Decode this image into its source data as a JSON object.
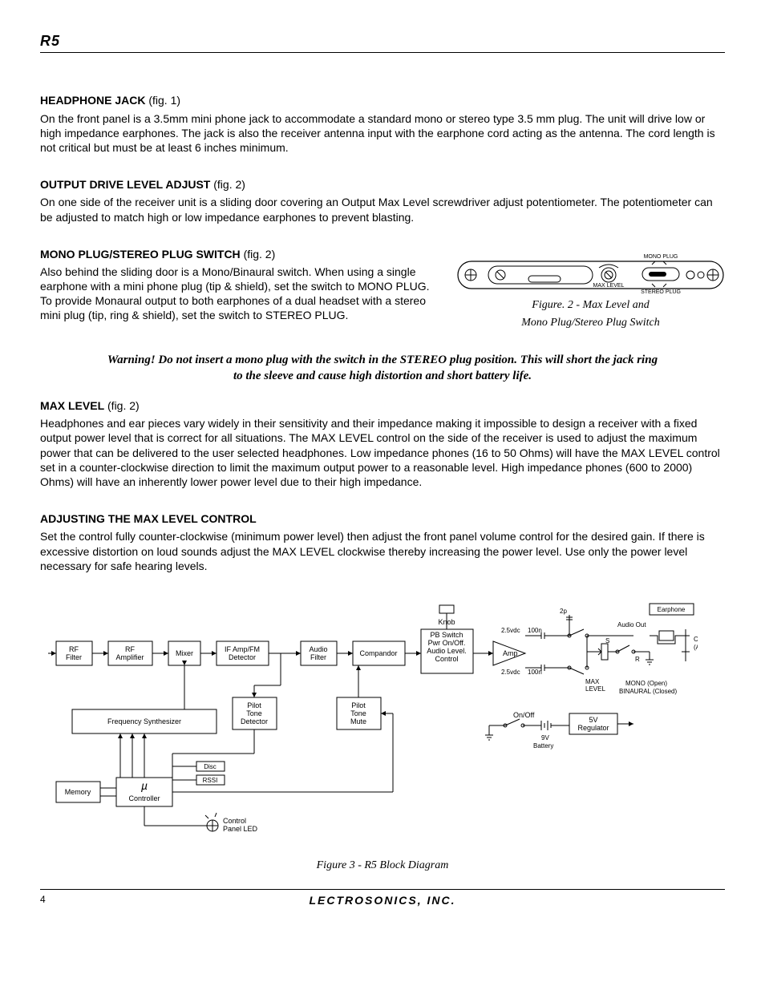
{
  "header": {
    "model": "R5"
  },
  "sections": {
    "headphone": {
      "title": "HEADPHONE JACK",
      "fig": "(fig. 1)",
      "body": "On the front panel is a 3.5mm mini phone jack to accommodate a standard mono or stereo type 3.5 mm plug.  The unit will drive low or high impedance earphones.  The jack is also the receiver antenna input with the earphone cord acting as the antenna.  The cord length is not critical but must be at least 6 inches minimum."
    },
    "output": {
      "title": "OUTPUT DRIVE LEVEL ADJUST",
      "fig": "(fig. 2)",
      "body": "On one side of the receiver unit is a sliding door covering an Output Max Level screwdriver adjust potentiometer.  The potentiometer can be adjusted to match high or low impedance earphones to prevent blasting."
    },
    "mono": {
      "title": "MONO PLUG/STEREO PLUG SWITCH",
      "fig": "(fig. 2)",
      "body": "Also behind the sliding door is a Mono/Binaural switch.  When using a single earphone with a mini phone plug (tip & shield), set the switch to MONO PLUG.  To provide Monaural output to both earphones of a dual headset with a stereo mini plug (tip, ring & shield), set the switch to STEREO PLUG."
    },
    "maxlevel": {
      "title": "MAX LEVEL",
      "fig": "(fig. 2)",
      "body": "Headphones and ear pieces vary widely in their sensitivity and their impedance making it impossible to design a receiver with a fixed output power level that is correct for all situations.  The MAX LEVEL control on the side of the receiver is used to adjust the maximum power that can be delivered to the user selected headphones.  Low impedance phones (16 to 50 Ohms) will have the MAX LEVEL control set in a counter-clockwise direction to limit the maximum output power to a reasonable level.  High impedance phones (600 to 2000) Ohms) will have an inherently lower power level due to their high impedance."
    },
    "adjust": {
      "title": "ADJUSTING THE MAX LEVEL CONTROL",
      "body": "Set the control fully counter-clockwise (minimum power level) then adjust the front panel volume control for the desired gain.  If there is excessive distortion on loud sounds adjust the MAX LEVEL clockwise thereby increasing the power level.  Use only the power level necessary for safe hearing levels."
    }
  },
  "warning": "Warning!  Do not insert a mono plug with the switch in the STEREO plug position.  This will short the jack ring to the sleeve and cause high distortion and short battery life.",
  "fig2": {
    "caption1": "Figure. 2 - Max Level and",
    "caption2": "Mono Plug/Stereo Plug Switch",
    "labels": {
      "mono": "MONO PLUG",
      "stereo": "STEREO PLUG",
      "max": "MAX LEVEL"
    }
  },
  "fig3": {
    "caption": "Figure 3 - R5 Block Diagram",
    "labels": {
      "rf_filter": "RF Filter",
      "rf_amp": "RF Amplifier",
      "mixer": "Mixer",
      "if_amp": "IF Amp/FM Detector",
      "audio_filter": "Audio Filter",
      "compandor": "Compandor",
      "knob": "Knob",
      "pb_switch": "PB Switch Pwr On/Off. Audio Level. Control",
      "amp": "Amp",
      "earphone": "Earphone",
      "cord": "Cord (Ant.)",
      "freq_synth": "Frequency Synthesizer",
      "pilot_detect": "Pilot Tone Detector",
      "pilot_mute": "Pilot Tone Mute",
      "memory": "Memory",
      "controller": "Controller",
      "mu": "µ",
      "disc": "Disc",
      "rssi": "RSSI",
      "panel_led": "Control Panel LED",
      "onoff": "On/Off",
      "battery": "9V Battery",
      "regulator": "5V Regulator",
      "max_level": "MAX LEVEL",
      "mono_open": "MONO (Open)",
      "binaural": "BINAURAL (Closed)",
      "audio_out": "Audio Out",
      "v25a": "2.5vdc",
      "v25b": "2.5vdc",
      "c100a": "100n",
      "c100b": "100n",
      "c2p": "2p",
      "s": "S",
      "r": "R"
    }
  },
  "footer": {
    "page": "4",
    "company": "LECTROSONICS, INC."
  }
}
